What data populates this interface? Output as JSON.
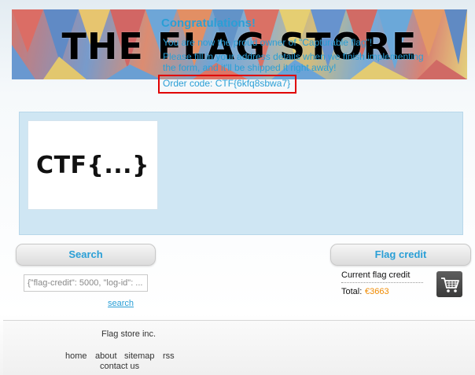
{
  "banner": {
    "title": "THE FLAG STORE"
  },
  "order": {
    "product_image_text": "CTF{...}",
    "title": "Congratulations!",
    "message_owner": "You are now the proud owner of \"Capturable flag\"!",
    "message_address": "Please fill in your address details when we finish implementing the form, and it'll be shipped it right away!",
    "order_code": "Order code: CTF{6kfq8sbwa7}",
    "highlight_color": "#e00000"
  },
  "search": {
    "header": "Search",
    "input_value": "{\"flag-credit\": 5000, \"log-id\": ...",
    "link": "search"
  },
  "credit": {
    "header": "Flag credit",
    "current_label": "Current flag credit",
    "total_label": "Total:",
    "total_value": "€3663",
    "icon": "shopping-cart-icon"
  },
  "footer": {
    "company": "Flag store inc.",
    "links": {
      "home": "home",
      "about": "about",
      "sitemap": "sitemap",
      "rss": "rss",
      "contact": "contact us"
    }
  },
  "colors": {
    "accent": "#2a9fd6",
    "price": "#f08a00",
    "panel_bg": "#cfe6f3"
  }
}
